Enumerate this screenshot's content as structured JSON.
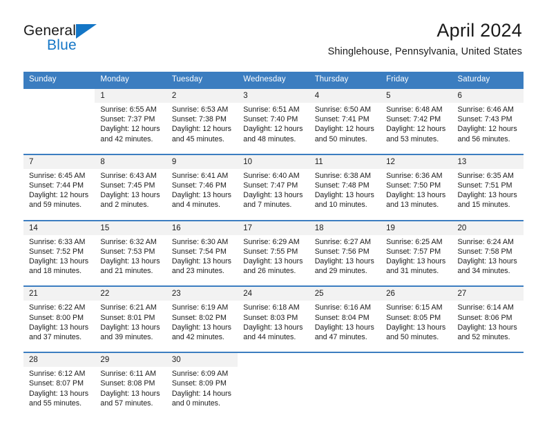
{
  "brand": {
    "name_part1": "General",
    "name_part2": "Blue",
    "triangle_icon": "triangle-icon",
    "accent_color": "#1476c6"
  },
  "header": {
    "title": "April 2024",
    "subtitle": "Shinglehouse, Pennsylvania, United States"
  },
  "theme": {
    "header_bg": "#3b7dc0",
    "daynum_bg": "#f2f2f2",
    "text": "#1a1a1a"
  },
  "calendar": {
    "weekday_headers": [
      "Sunday",
      "Monday",
      "Tuesday",
      "Wednesday",
      "Thursday",
      "Friday",
      "Saturday"
    ],
    "weeks": [
      {
        "days": [
          {
            "num": "",
            "sunrise": "",
            "sunset": "",
            "daylight_line1": "",
            "daylight_line2": ""
          },
          {
            "num": "1",
            "sunrise": "Sunrise: 6:55 AM",
            "sunset": "Sunset: 7:37 PM",
            "daylight_line1": "Daylight: 12 hours",
            "daylight_line2": "and 42 minutes."
          },
          {
            "num": "2",
            "sunrise": "Sunrise: 6:53 AM",
            "sunset": "Sunset: 7:38 PM",
            "daylight_line1": "Daylight: 12 hours",
            "daylight_line2": "and 45 minutes."
          },
          {
            "num": "3",
            "sunrise": "Sunrise: 6:51 AM",
            "sunset": "Sunset: 7:40 PM",
            "daylight_line1": "Daylight: 12 hours",
            "daylight_line2": "and 48 minutes."
          },
          {
            "num": "4",
            "sunrise": "Sunrise: 6:50 AM",
            "sunset": "Sunset: 7:41 PM",
            "daylight_line1": "Daylight: 12 hours",
            "daylight_line2": "and 50 minutes."
          },
          {
            "num": "5",
            "sunrise": "Sunrise: 6:48 AM",
            "sunset": "Sunset: 7:42 PM",
            "daylight_line1": "Daylight: 12 hours",
            "daylight_line2": "and 53 minutes."
          },
          {
            "num": "6",
            "sunrise": "Sunrise: 6:46 AM",
            "sunset": "Sunset: 7:43 PM",
            "daylight_line1": "Daylight: 12 hours",
            "daylight_line2": "and 56 minutes."
          }
        ]
      },
      {
        "days": [
          {
            "num": "7",
            "sunrise": "Sunrise: 6:45 AM",
            "sunset": "Sunset: 7:44 PM",
            "daylight_line1": "Daylight: 12 hours",
            "daylight_line2": "and 59 minutes."
          },
          {
            "num": "8",
            "sunrise": "Sunrise: 6:43 AM",
            "sunset": "Sunset: 7:45 PM",
            "daylight_line1": "Daylight: 13 hours",
            "daylight_line2": "and 2 minutes."
          },
          {
            "num": "9",
            "sunrise": "Sunrise: 6:41 AM",
            "sunset": "Sunset: 7:46 PM",
            "daylight_line1": "Daylight: 13 hours",
            "daylight_line2": "and 4 minutes."
          },
          {
            "num": "10",
            "sunrise": "Sunrise: 6:40 AM",
            "sunset": "Sunset: 7:47 PM",
            "daylight_line1": "Daylight: 13 hours",
            "daylight_line2": "and 7 minutes."
          },
          {
            "num": "11",
            "sunrise": "Sunrise: 6:38 AM",
            "sunset": "Sunset: 7:48 PM",
            "daylight_line1": "Daylight: 13 hours",
            "daylight_line2": "and 10 minutes."
          },
          {
            "num": "12",
            "sunrise": "Sunrise: 6:36 AM",
            "sunset": "Sunset: 7:50 PM",
            "daylight_line1": "Daylight: 13 hours",
            "daylight_line2": "and 13 minutes."
          },
          {
            "num": "13",
            "sunrise": "Sunrise: 6:35 AM",
            "sunset": "Sunset: 7:51 PM",
            "daylight_line1": "Daylight: 13 hours",
            "daylight_line2": "and 15 minutes."
          }
        ]
      },
      {
        "days": [
          {
            "num": "14",
            "sunrise": "Sunrise: 6:33 AM",
            "sunset": "Sunset: 7:52 PM",
            "daylight_line1": "Daylight: 13 hours",
            "daylight_line2": "and 18 minutes."
          },
          {
            "num": "15",
            "sunrise": "Sunrise: 6:32 AM",
            "sunset": "Sunset: 7:53 PM",
            "daylight_line1": "Daylight: 13 hours",
            "daylight_line2": "and 21 minutes."
          },
          {
            "num": "16",
            "sunrise": "Sunrise: 6:30 AM",
            "sunset": "Sunset: 7:54 PM",
            "daylight_line1": "Daylight: 13 hours",
            "daylight_line2": "and 23 minutes."
          },
          {
            "num": "17",
            "sunrise": "Sunrise: 6:29 AM",
            "sunset": "Sunset: 7:55 PM",
            "daylight_line1": "Daylight: 13 hours",
            "daylight_line2": "and 26 minutes."
          },
          {
            "num": "18",
            "sunrise": "Sunrise: 6:27 AM",
            "sunset": "Sunset: 7:56 PM",
            "daylight_line1": "Daylight: 13 hours",
            "daylight_line2": "and 29 minutes."
          },
          {
            "num": "19",
            "sunrise": "Sunrise: 6:25 AM",
            "sunset": "Sunset: 7:57 PM",
            "daylight_line1": "Daylight: 13 hours",
            "daylight_line2": "and 31 minutes."
          },
          {
            "num": "20",
            "sunrise": "Sunrise: 6:24 AM",
            "sunset": "Sunset: 7:58 PM",
            "daylight_line1": "Daylight: 13 hours",
            "daylight_line2": "and 34 minutes."
          }
        ]
      },
      {
        "days": [
          {
            "num": "21",
            "sunrise": "Sunrise: 6:22 AM",
            "sunset": "Sunset: 8:00 PM",
            "daylight_line1": "Daylight: 13 hours",
            "daylight_line2": "and 37 minutes."
          },
          {
            "num": "22",
            "sunrise": "Sunrise: 6:21 AM",
            "sunset": "Sunset: 8:01 PM",
            "daylight_line1": "Daylight: 13 hours",
            "daylight_line2": "and 39 minutes."
          },
          {
            "num": "23",
            "sunrise": "Sunrise: 6:19 AM",
            "sunset": "Sunset: 8:02 PM",
            "daylight_line1": "Daylight: 13 hours",
            "daylight_line2": "and 42 minutes."
          },
          {
            "num": "24",
            "sunrise": "Sunrise: 6:18 AM",
            "sunset": "Sunset: 8:03 PM",
            "daylight_line1": "Daylight: 13 hours",
            "daylight_line2": "and 44 minutes."
          },
          {
            "num": "25",
            "sunrise": "Sunrise: 6:16 AM",
            "sunset": "Sunset: 8:04 PM",
            "daylight_line1": "Daylight: 13 hours",
            "daylight_line2": "and 47 minutes."
          },
          {
            "num": "26",
            "sunrise": "Sunrise: 6:15 AM",
            "sunset": "Sunset: 8:05 PM",
            "daylight_line1": "Daylight: 13 hours",
            "daylight_line2": "and 50 minutes."
          },
          {
            "num": "27",
            "sunrise": "Sunrise: 6:14 AM",
            "sunset": "Sunset: 8:06 PM",
            "daylight_line1": "Daylight: 13 hours",
            "daylight_line2": "and 52 minutes."
          }
        ]
      },
      {
        "days": [
          {
            "num": "28",
            "sunrise": "Sunrise: 6:12 AM",
            "sunset": "Sunset: 8:07 PM",
            "daylight_line1": "Daylight: 13 hours",
            "daylight_line2": "and 55 minutes."
          },
          {
            "num": "29",
            "sunrise": "Sunrise: 6:11 AM",
            "sunset": "Sunset: 8:08 PM",
            "daylight_line1": "Daylight: 13 hours",
            "daylight_line2": "and 57 minutes."
          },
          {
            "num": "30",
            "sunrise": "Sunrise: 6:09 AM",
            "sunset": "Sunset: 8:09 PM",
            "daylight_line1": "Daylight: 14 hours",
            "daylight_line2": "and 0 minutes."
          },
          {
            "num": "",
            "sunrise": "",
            "sunset": "",
            "daylight_line1": "",
            "daylight_line2": ""
          },
          {
            "num": "",
            "sunrise": "",
            "sunset": "",
            "daylight_line1": "",
            "daylight_line2": ""
          },
          {
            "num": "",
            "sunrise": "",
            "sunset": "",
            "daylight_line1": "",
            "daylight_line2": ""
          },
          {
            "num": "",
            "sunrise": "",
            "sunset": "",
            "daylight_line1": "",
            "daylight_line2": ""
          }
        ]
      }
    ]
  }
}
